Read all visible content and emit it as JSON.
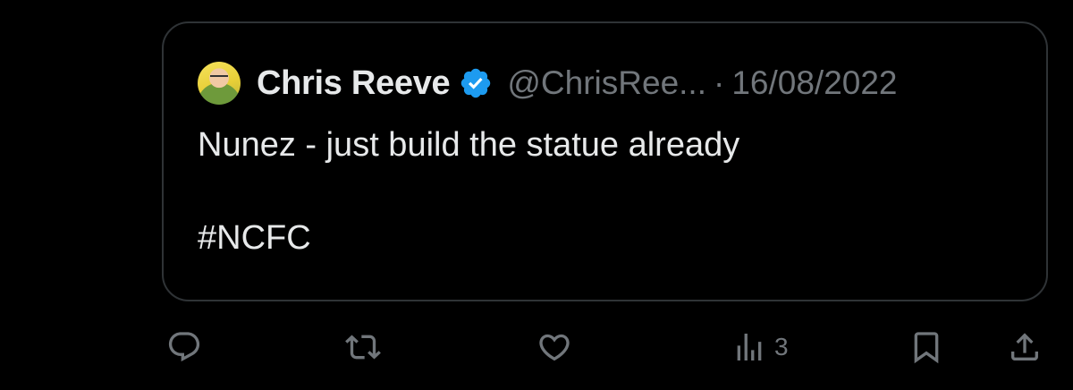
{
  "quoted_tweet": {
    "author": {
      "display_name": "Chris Reeve",
      "handle": "@ChrisRee...",
      "verified": true,
      "avatar_icon": "avatar-photo"
    },
    "separator": "·",
    "date": "16/08/2022",
    "text": "Nunez - just build the statue already\n\n#NCFC"
  },
  "actions": {
    "reply_icon": "reply-icon",
    "retweet_icon": "retweet-icon",
    "like_icon": "heart-icon",
    "views_icon": "views-chart-icon",
    "views_count": "3",
    "bookmark_icon": "bookmark-icon",
    "share_icon": "share-icon"
  },
  "colors": {
    "background": "#000000",
    "primary_text": "#e7e9ea",
    "secondary_text": "#71767b",
    "border": "#2f3336",
    "verified_blue": "#1d9bf0"
  }
}
